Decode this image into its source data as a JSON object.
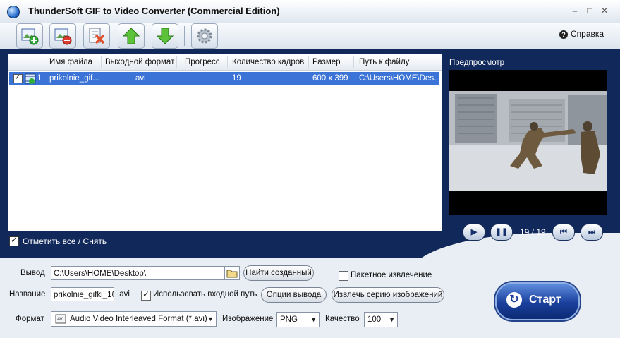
{
  "window": {
    "title": "ThunderSoft GIF to Video Converter (Commercial Edition)",
    "help_label": "Справка"
  },
  "toolbar": {
    "icons": [
      "add-file-icon",
      "remove-file-icon",
      "clear-list-icon",
      "move-up-icon",
      "move-down-icon",
      "settings-icon"
    ]
  },
  "list": {
    "columns": [
      "Имя файла",
      "Выходной формат",
      "Прогресс",
      "Количество кадров",
      "Размер",
      "Путь к файлу"
    ],
    "rows": [
      {
        "index": "1",
        "name": "prikolnie_gif...",
        "format": "avi",
        "progress": "",
        "frames": "19",
        "size": "600 x 399",
        "path": "C:\\Users\\HOME\\Des..."
      }
    ],
    "check_all_label": "Отметить все / Снять"
  },
  "preview": {
    "label": "Предпросмотр",
    "frame_counter": "19 / 19"
  },
  "output": {
    "output_label": "Вывод",
    "output_path": "C:\\Users\\HOME\\Desktop\\",
    "find_created_label": "Найти созданный",
    "batch_extract_label": "Пакетное извлечение",
    "batch_extract_checked": false,
    "name_label": "Название",
    "name_value": "prikolnie_gifki_16",
    "name_ext": ".avi",
    "use_input_path_label": "Использовать входной путь",
    "use_input_path_checked": true,
    "output_options_label": "Опции вывода",
    "extract_series_label": "Извлечь серию изображений",
    "format_label": "Формат",
    "format_value": "Audio Video Interleaved Format (*.avi)",
    "image_label": "Изображение",
    "image_value": "PNG",
    "quality_label": "Качество",
    "quality_value": "100",
    "start_label": "Старт"
  },
  "colors": {
    "panel_navy": "#11285a",
    "selection_blue": "#3b74d6",
    "start_blue": "#1a3f9c"
  }
}
